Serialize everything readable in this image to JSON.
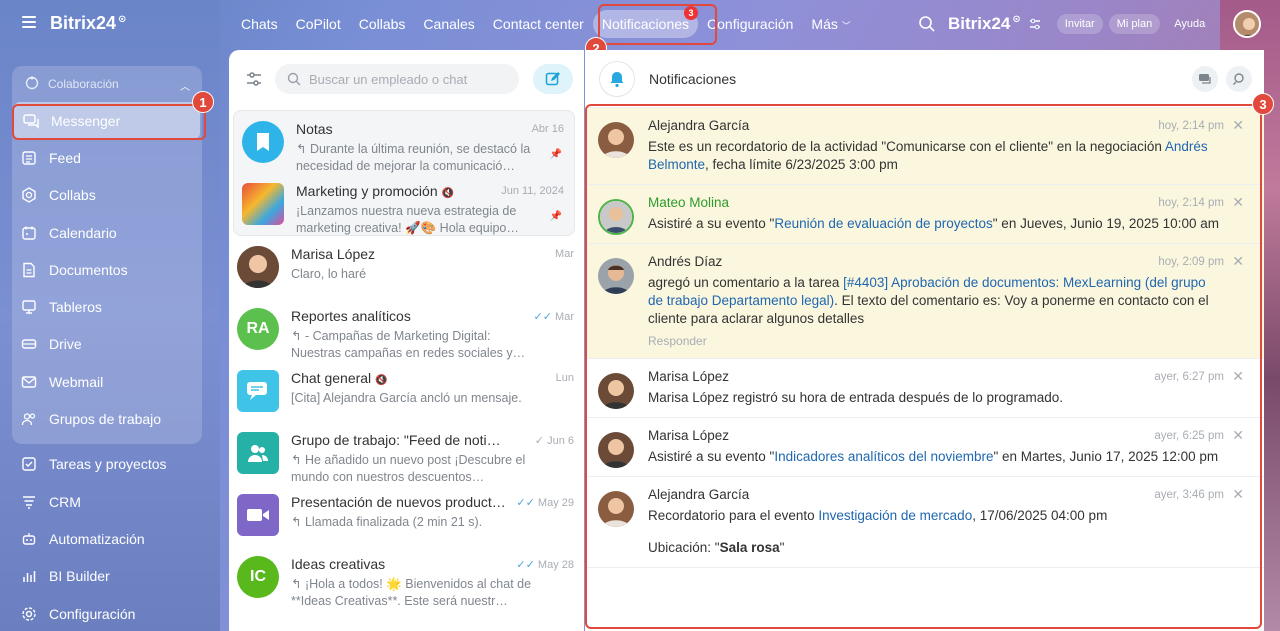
{
  "app": {
    "logo": "Bitrix24",
    "logo_mark": "⊙"
  },
  "topnav": {
    "tabs": [
      {
        "label": "Chats"
      },
      {
        "label": "CoPilot"
      },
      {
        "label": "Collabs"
      },
      {
        "label": "Canales"
      },
      {
        "label": "Contact center"
      },
      {
        "label": "Notificaciones",
        "badge": "3"
      },
      {
        "label": "Configuración"
      },
      {
        "label": "Más"
      }
    ],
    "right_logo": "Bitrix24",
    "invite": "Invitar",
    "plan": "Mi plan",
    "help": "Ayuda"
  },
  "sidebar": {
    "group_label": "Colaboración",
    "items": [
      {
        "label": "Messenger",
        "icon": "chat-bubbles-icon"
      },
      {
        "label": "Feed",
        "icon": "feed-icon"
      },
      {
        "label": "Collabs",
        "icon": "hexagon-icon"
      },
      {
        "label": "Calendario",
        "icon": "calendar-icon"
      },
      {
        "label": "Documentos",
        "icon": "document-icon"
      },
      {
        "label": "Tableros",
        "icon": "board-icon"
      },
      {
        "label": "Drive",
        "icon": "drive-icon"
      },
      {
        "label": "Webmail",
        "icon": "mail-icon"
      },
      {
        "label": "Grupos de trabajo",
        "icon": "group-icon"
      }
    ],
    "other_items": [
      {
        "label": "Tareas y proyectos",
        "icon": "checkbox-icon"
      },
      {
        "label": "CRM",
        "icon": "crm-icon"
      },
      {
        "label": "Automatización",
        "icon": "robot-icon"
      },
      {
        "label": "BI Builder",
        "icon": "bi-chart-icon"
      },
      {
        "label": "Configuración",
        "icon": "gear-icon"
      }
    ]
  },
  "markers": {
    "m1": "1",
    "m2": "2",
    "m3": "3"
  },
  "chatlist": {
    "search_placeholder": "Buscar un empleado o chat",
    "pinned": [
      {
        "name": "Notas",
        "date": "Abr 16",
        "preview": "↰ Durante la última reunión, se destacó la necesidad de mejorar la comunicació…"
      },
      {
        "name": "Marketing y promoción",
        "date": "Jun 11, 2024",
        "preview": "¡Lanzamos nuestra nueva estrategia de marketing creativa! 🚀🎨 Hola equipo…"
      }
    ],
    "chats": [
      {
        "name": "Marisa López",
        "date": "Mar",
        "preview": "Claro, lo haré"
      },
      {
        "name": "Reportes analíticos",
        "date": "Mar",
        "initials": "RA",
        "preview": "↰ - Campañas de Marketing Digital: Nuestras campañas en redes sociales y…"
      },
      {
        "name": "Chat general",
        "date": "Lun",
        "preview": "[Cita] Alejandra García ancló un mensaje."
      },
      {
        "name": "Grupo de trabajo: \"Feed de notici…",
        "date": "Jun 6",
        "preview": "↰ He añadido un nuevo post ¡Descubre el mundo con nuestros descuentos…"
      },
      {
        "name": "Presentación de nuevos product…",
        "date": "May 29",
        "preview": "↰ Llamada finalizada (2 min 21 s)."
      },
      {
        "name": "Ideas creativas",
        "date": "May 28",
        "initials": "IC",
        "preview": "↰ ¡Hola a todos! 🌟 Bienvenidos al chat de **Ideas Creativas**. Este será nuestr…"
      }
    ]
  },
  "notifications": {
    "title": "Notificaciones",
    "items": [
      {
        "name": "Alejandra García",
        "time": "hoy, 2:14 pm",
        "text_a": "Este es un recordatorio de la actividad \"Comunicarse con el cliente\" en la negociación ",
        "link": "Andrés Belmonte",
        "text_b": ", fecha límite 6/23/2025 3:00 pm"
      },
      {
        "name": "Mateo Molina",
        "time": "hoy, 2:14 pm",
        "text_a": "Asistiré a su evento \"",
        "link": "Reunión de evaluación de proyectos",
        "text_b": "\" en Jueves, Junio 19, 2025 10:00 am"
      },
      {
        "name": "Andrés Díaz",
        "time": "hoy, 2:09 pm",
        "text_a": "agregó un comentario a la tarea ",
        "link": "[#4403] Aprobación de documentos: MexLearning (del grupo de trabajo Departamento legal)",
        "text_b": ". El texto del comentario es: Voy a ponerme en contacto con el cliente para aclarar algunos detalles",
        "reply": "Responder"
      },
      {
        "name": "Marisa López",
        "time": "ayer, 6:27 pm",
        "text_a": "Marisa López registró su hora de entrada después de lo programado."
      },
      {
        "name": "Marisa López",
        "time": "ayer, 6:25 pm",
        "text_a": "Asistiré a su evento \"",
        "link": "Indicadores analíticos del noviembre",
        "text_b": "\" en Martes, Junio 17, 2025 12:00 pm"
      },
      {
        "name": "Alejandra García",
        "time": "ayer, 3:46 pm",
        "text_a": "Recordatorio para el evento ",
        "link": "Investigación de mercado",
        "text_b": ", 17/06/2025 04:00 pm",
        "location_label": "Ubicación: \"",
        "location_value": "Sala rosa",
        "location_end": "\""
      }
    ]
  }
}
